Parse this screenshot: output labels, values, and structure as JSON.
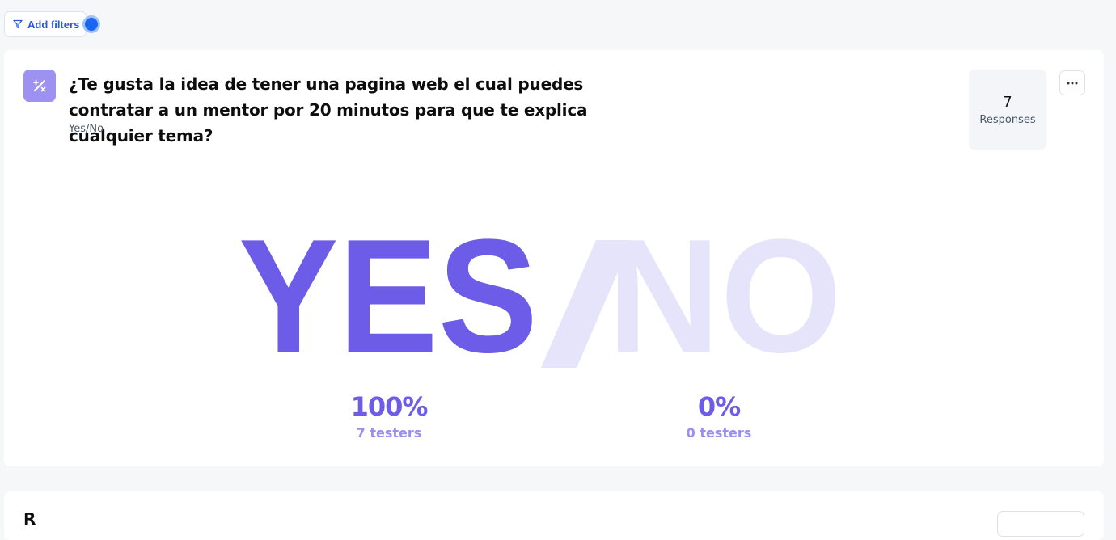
{
  "toolbar": {
    "add_filters_label": "Add filters"
  },
  "question": {
    "title": "¿Te gusta la idea de tener una pagina web el cual puedes contratar a un mentor por 20 minutos para que te explica cualquier tema?",
    "type_label": "Yes/No",
    "icon": "percent-icon"
  },
  "responses": {
    "count": "7",
    "label": "Responses"
  },
  "result": {
    "yes_word": "YES",
    "no_word": "NO",
    "yes_percent": "100%",
    "yes_testers": "7 testers",
    "no_percent": "0%",
    "no_testers": "0 testers"
  },
  "next_section": {
    "title": "R"
  },
  "colors": {
    "accent": "#6c5ce7",
    "accent_light": "#e6e4fb",
    "icon_bg": "#9d91f2",
    "link_blue": "#2b57d6"
  }
}
